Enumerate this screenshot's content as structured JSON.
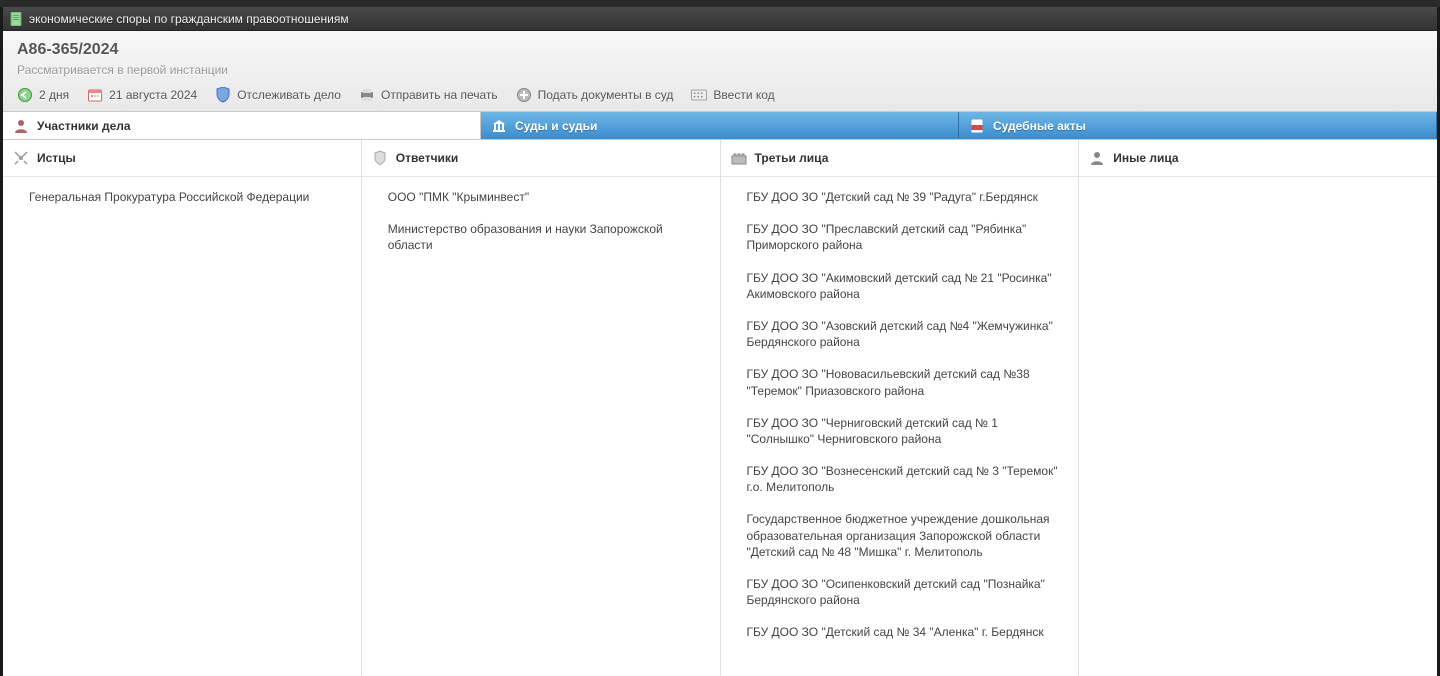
{
  "title_bar": {
    "title": "экономические споры по гражданским правоотношениям"
  },
  "case": {
    "number": "А86-365/2024",
    "status": "Рассматривается в первой инстанции"
  },
  "toolbar": {
    "duration": "2 дня",
    "date": "21 августа 2024",
    "follow": "Отслеживать дело",
    "print": "Отправить на печать",
    "submit": "Подать документы в суд",
    "enter_code": "Ввести код"
  },
  "tabs": {
    "participants": "Участники дела",
    "courts": "Суды и судьи",
    "acts": "Судебные акты"
  },
  "columns": {
    "plaintiffs": {
      "title": "Истцы",
      "items": [
        "Генеральная Прокуратура Российской Федерации"
      ]
    },
    "defendants": {
      "title": "Ответчики",
      "items": [
        "ООО \"ПМК \"Крыминвест\"",
        "Министерство образования и науки Запорожской области"
      ]
    },
    "third_parties": {
      "title": "Третьи лица",
      "items": [
        "ГБУ ДОО ЗО \"Детский сад № 39 \"Радуга\" г.Бердянск",
        "ГБУ ДОО ЗО \"Преславский детский сад \"Рябинка\" Приморского района",
        "ГБУ ДОО ЗО \"Акимовский детский сад № 21 \"Росинка\" Акимовского района",
        "ГБУ ДОО ЗО \"Азовский детский сад №4 \"Жемчужинка\" Бердянского района",
        "ГБУ ДОО ЗО \"Нововасильевский детский сад №38 \"Теремок\" Приазовского района",
        "ГБУ ДОО ЗО \"Черниговский детский сад № 1 \"Солнышко\" Черниговского района",
        "ГБУ ДОО ЗО \"Вознесенский детский сад № 3 \"Теремок\" г.о. Мелитополь",
        "Государственное бюджетное учреждение дошкольная образовательная организация Запорожской области \"Детский сад № 48 \"Мишка\" г. Мелитополь",
        "ГБУ ДОО ЗО \"Осипенковский детский сад \"Познайка\" Бердянского района",
        "ГБУ ДОО ЗО \"Детский сад № 34 \"Аленка\" г. Бердянск"
      ]
    },
    "others": {
      "title": "Иные лица",
      "items": []
    }
  }
}
